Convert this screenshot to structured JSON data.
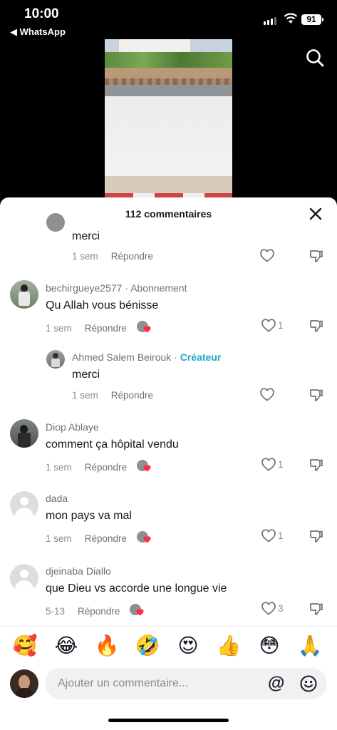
{
  "status_bar": {
    "time": "10:00",
    "back_app": "◀ WhatsApp",
    "battery": "91"
  },
  "icons": {
    "search": "search-icon",
    "close": "close-icon",
    "heart": "heart-icon",
    "dislike": "thumbs-down-icon",
    "emoji": "smiley-icon",
    "at": "@"
  },
  "sheet": {
    "title": "112 commentaires"
  },
  "comments": [
    {
      "author": "",
      "text": "merci",
      "time": "1 sem",
      "reply_label": "Répondre",
      "likes": "",
      "is_reply": true
    },
    {
      "author": "bechirgueye2577",
      "author_suffix": " · Abonnement",
      "text": "Qu Allah vous bénisse",
      "time": "1 sem",
      "reply_label": "Répondre",
      "likes": "1"
    },
    {
      "author": "Ahmed Salem Beirouk",
      "author_suffix": " · ",
      "creator_label": "Créateur",
      "text": "merci",
      "time": "1 sem",
      "reply_label": "Répondre",
      "likes": "",
      "is_reply": true
    },
    {
      "author": "Diop Ablaye",
      "text": "comment ça hôpital vendu",
      "time": "1 sem",
      "reply_label": "Répondre",
      "likes": "1"
    },
    {
      "author": "dada",
      "text": "mon pays va mal",
      "time": "1 sem",
      "reply_label": "Répondre",
      "likes": "1"
    },
    {
      "author": "djeinaba Diallo",
      "text": "que Dieu vs accorde une longue vie",
      "time": "5-13",
      "reply_label": "Répondre",
      "likes": "3"
    }
  ],
  "emoji_bar": [
    "🥰",
    "😂",
    "🔥",
    "🤣",
    "😍",
    "👍",
    "😳",
    "🙏"
  ],
  "input": {
    "placeholder": "Ajouter un commentaire..."
  },
  "colors": {
    "creator": "#20a7c4",
    "heart_badge": "#fe2c55"
  }
}
